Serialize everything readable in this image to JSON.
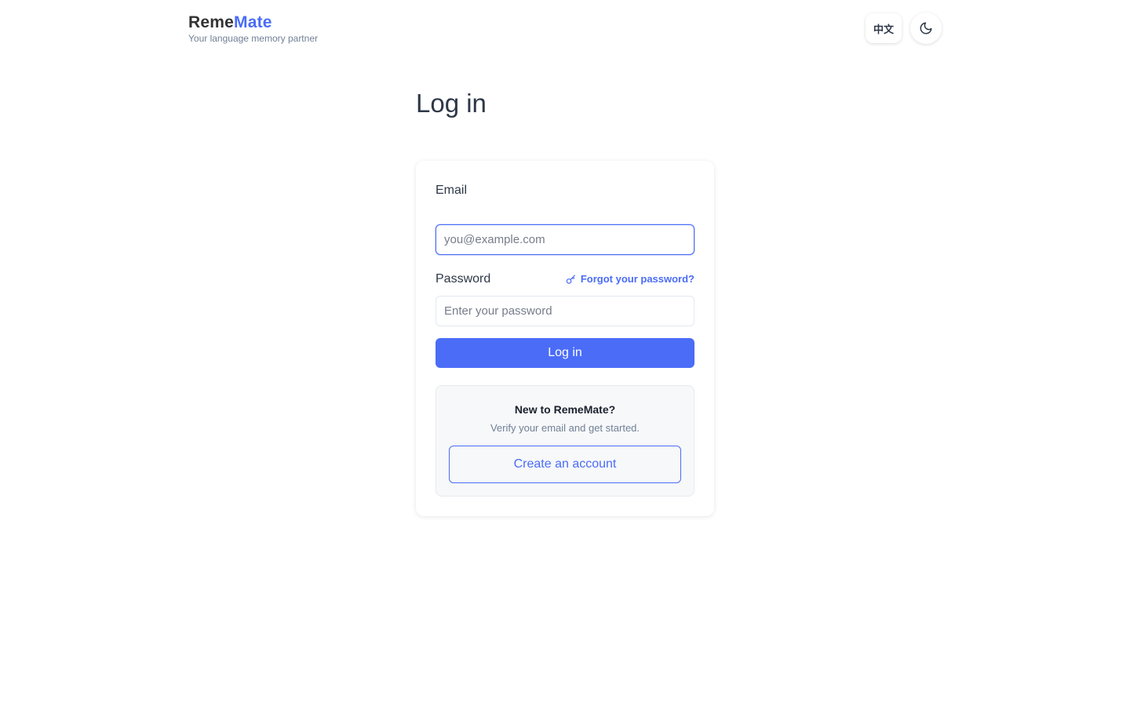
{
  "header": {
    "brand_part1": "Reme",
    "brand_part2": "Mate",
    "tagline": "Your language memory partner",
    "language_toggle_label": "中文",
    "theme_toggle_icon": "moon-icon"
  },
  "page_title": "Log in",
  "form": {
    "email_label": "Email",
    "email_placeholder": "you@example.com",
    "email_value": "",
    "password_label": "Password",
    "password_placeholder": "Enter your password",
    "password_value": "",
    "forgot_link": "Forgot your password?",
    "forgot_icon": "key-icon",
    "submit_label": "Log in"
  },
  "signup": {
    "title": "New to RemeMate?",
    "subtitle": "Verify your email and get started.",
    "button_label": "Create an account"
  },
  "colors": {
    "accent": "#4a6cf7",
    "text": "#2d3748",
    "muted": "#718096"
  }
}
